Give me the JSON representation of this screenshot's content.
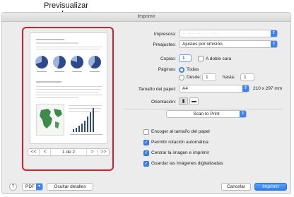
{
  "callout": {
    "label": "Previsualizar"
  },
  "window": {
    "title": "Imprimir"
  },
  "preview": {
    "pager": {
      "first": "<<",
      "prev": "<",
      "page_text": "1 de 2",
      "next": ">",
      "last": ">>"
    }
  },
  "printer": {
    "label": "Impresora:",
    "value": "·· ········ ·· ·····"
  },
  "presets": {
    "label": "Preajustes:",
    "value": "Ajustes por omisión"
  },
  "copies": {
    "label": "Copias:",
    "value": "1",
    "duplex_label": "A doble cara"
  },
  "pages": {
    "label": "Páginas:",
    "all_label": "Todas",
    "from_label": "Desde:",
    "from_value": "1",
    "to_label": "hasta:",
    "to_value": "1"
  },
  "paper_size": {
    "label": "Tamaño del papel:",
    "value": "A4",
    "dimensions": "210 x 297 mm"
  },
  "orientation": {
    "label": "Orientación:"
  },
  "section_popup": {
    "value": "Scan to Print"
  },
  "options": [
    {
      "label": "Encoger al tamaño del papel",
      "checked": false
    },
    {
      "label": "Permitir rotación automática",
      "checked": true
    },
    {
      "label": "Centrar la imagen e imprimir",
      "checked": true
    },
    {
      "label": "Guardar las imágenes digitalizadas",
      "checked": true
    }
  ],
  "footer": {
    "help": "?",
    "pdf": "PDF",
    "hide_details": "Ocultar detalles",
    "cancel": "Cancelar",
    "print": "Imprimir"
  },
  "colors": {
    "accent": "#3b82f6",
    "callout_border": "#d61f2b",
    "chart_blue": "#2c4a8a"
  }
}
